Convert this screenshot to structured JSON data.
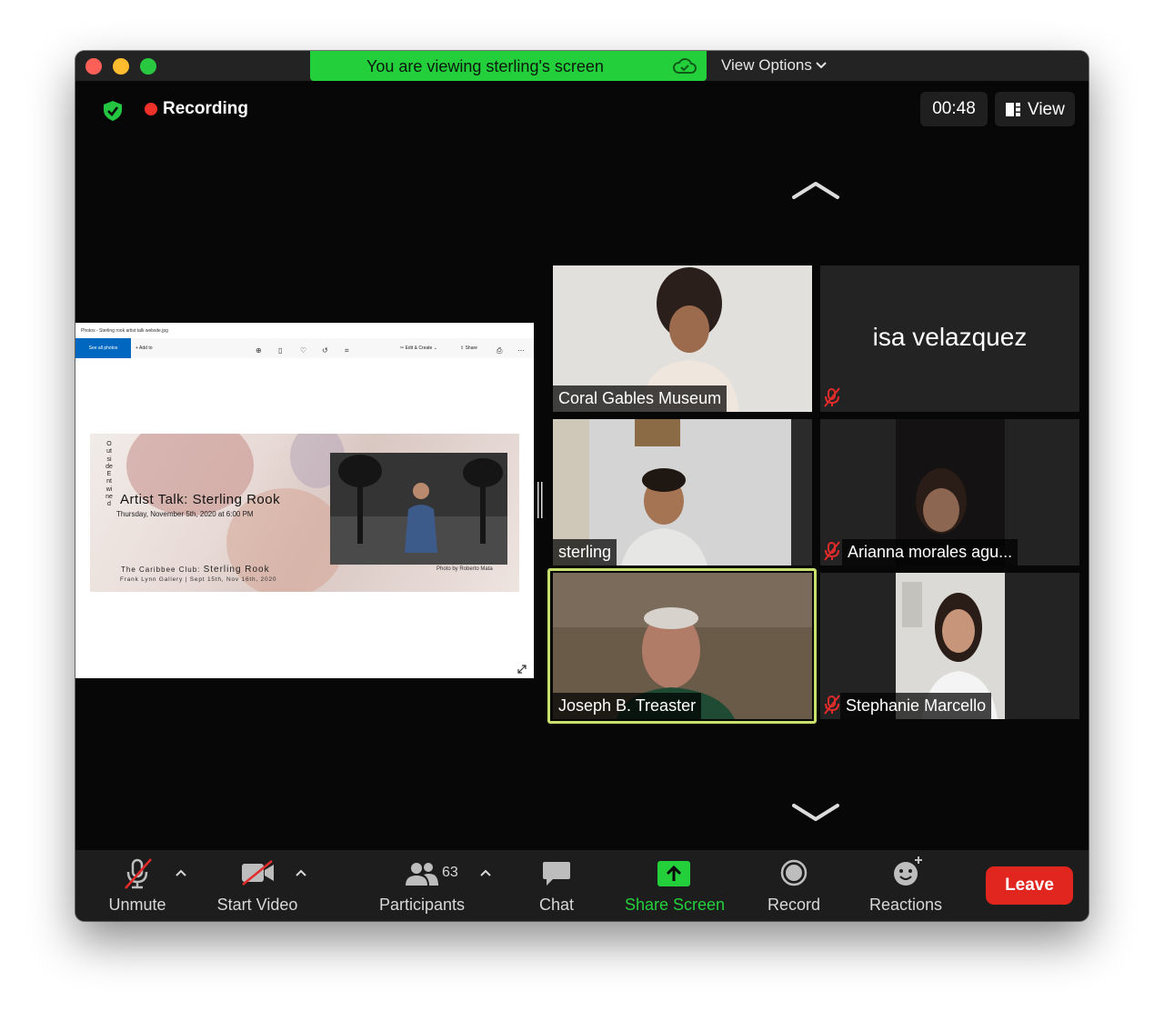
{
  "banner": {
    "text": "You are viewing sterling's screen",
    "view_options_label": "View Options"
  },
  "header": {
    "recording_label": "Recording",
    "timer": "00:48",
    "view_label": "View"
  },
  "shared_screen": {
    "window_title": "Photos - Sterling rook artist talk website.jpg",
    "toolbar": {
      "see_all": "See all photos",
      "add_to": "Add to",
      "edit_create": "Edit & Create",
      "share": "Share"
    },
    "poster": {
      "vertical_text": "Outside Entwined",
      "title": "Artist Talk: Sterling Rook",
      "date": "Thursday, November 5th, 2020 at 6:00 PM",
      "club_prefix": "The Caribbee Club: ",
      "club_name": "Sterling Rook",
      "gallery": "Frank Lynn Gallery | Sept 15th, Nov 16th, 2020",
      "credit": "Photo by Roberto Mata"
    }
  },
  "participants_tiles": [
    {
      "name": "Coral Gables Museum",
      "muted": false,
      "video": true
    },
    {
      "name": "isa velazquez",
      "muted": true,
      "video": false
    },
    {
      "name": "sterling",
      "muted": false,
      "video": true
    },
    {
      "name": "Arianna morales agu...",
      "muted": true,
      "video": true
    },
    {
      "name": "Joseph B. Treaster",
      "muted": false,
      "video": true,
      "active_speaker": true
    },
    {
      "name": "Stephanie Marcello",
      "muted": true,
      "video": true
    }
  ],
  "toolbar": {
    "unmute": "Unmute",
    "start_video": "Start Video",
    "participants": "Participants",
    "participants_count": "63",
    "chat": "Chat",
    "share_screen": "Share Screen",
    "record": "Record",
    "reactions": "Reactions",
    "leave": "Leave"
  },
  "colors": {
    "banner_green": "#23d03c",
    "share_screen_green": "#23d03c",
    "leave_red": "#e0261e",
    "active_speaker_border": "#c8e06e",
    "recording_red": "#f0312a"
  }
}
